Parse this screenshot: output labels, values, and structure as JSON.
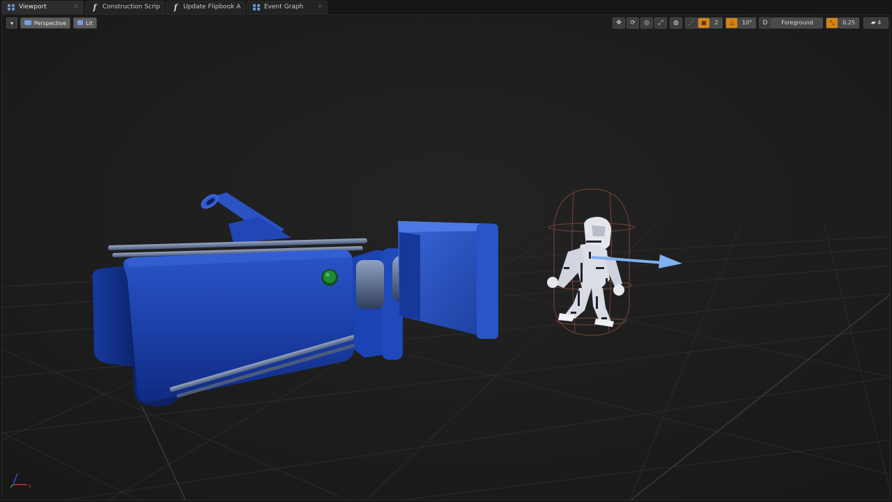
{
  "tabs": [
    {
      "label": "Viewport",
      "icon": "viewport-grid-icon"
    },
    {
      "label": "Construction Scrip",
      "icon": "function-icon"
    },
    {
      "label": "Update Flipbook A",
      "icon": "function-icon"
    },
    {
      "label": "Event Graph",
      "icon": "event-graph-icon"
    }
  ],
  "toolbar_left": {
    "perspective_label": "Perspective",
    "lit_label": "Lit"
  },
  "toolbar_right": {
    "grid_snap_value": "2",
    "rotation_snap_value": "10°",
    "layer_label": "Foreground",
    "scale_snap_value": "0.25",
    "camera_speed_value": "4"
  },
  "axis": {
    "x_label": "x"
  },
  "colors": {
    "accent_orange": "#e08a10",
    "camera_blue": "#1f44b0",
    "arrow_blue": "#7fb0f0"
  }
}
